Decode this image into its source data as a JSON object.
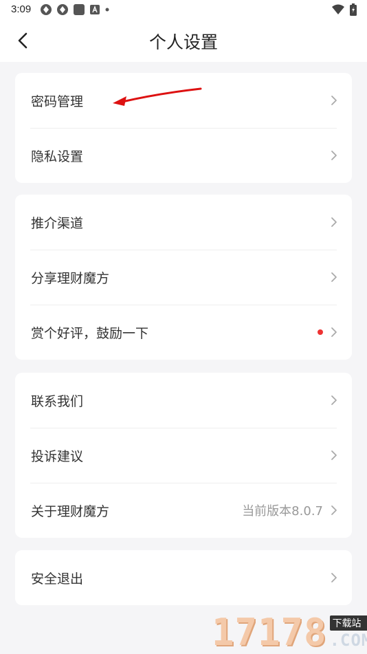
{
  "status_bar": {
    "time": "3:09",
    "icons_left": [
      "app-icon-1",
      "app-icon-2",
      "app-icon-3",
      "app-icon-a",
      "dot"
    ],
    "icons_right": [
      "wifi-icon",
      "battery-icon"
    ]
  },
  "nav": {
    "title": "个人设置"
  },
  "groups": [
    {
      "rows": [
        {
          "label": "密码管理"
        },
        {
          "label": "隐私设置"
        }
      ]
    },
    {
      "rows": [
        {
          "label": "推介渠道"
        },
        {
          "label": "分享理财魔方"
        },
        {
          "label": "赏个好评，鼓励一下",
          "has_red_dot": true
        }
      ]
    },
    {
      "rows": [
        {
          "label": "联系我们"
        },
        {
          "label": "投诉建议"
        },
        {
          "label": "关于理财魔方",
          "value": "当前版本8.0.7"
        }
      ]
    },
    {
      "rows": [
        {
          "label": "安全退出"
        }
      ]
    }
  ],
  "colors": {
    "background": "#f5f5f7",
    "card": "#ffffff",
    "red_dot": "#ee3333",
    "annotation_arrow": "#dd1111"
  },
  "watermark": {
    "number": "17178",
    "badge": "下载站",
    "suffix": ".COM"
  }
}
